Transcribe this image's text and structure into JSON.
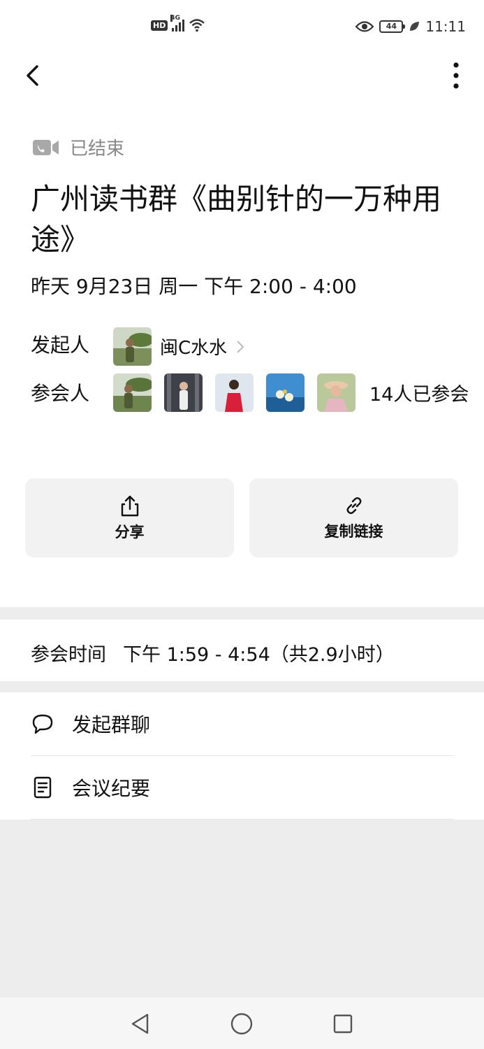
{
  "status_bar": {
    "hd": "HD",
    "network": "4G",
    "battery": "44",
    "time": "11:11",
    "icons": [
      "signal-icon",
      "wifi-icon",
      "eye-icon",
      "battery-icon",
      "leaf-icon"
    ]
  },
  "nav": {
    "back_icon": "chevron-left-icon",
    "more_icon": "more-vertical-icon"
  },
  "meeting": {
    "status": "已结束",
    "title": "广州读书群《曲别针的一万种用途》",
    "datetime": "昨天 9月23日 周一 下午 2:00 - 4:00",
    "organizer_label": "发起人",
    "organizer_name": "闽C水水",
    "participants_label": "参会人",
    "participant_count": "14人已参会"
  },
  "actions": {
    "share": "分享",
    "copy_link": "复制链接"
  },
  "join_time": {
    "label": "参会时间",
    "value": "下午 1:59 - 4:54（共2.9小时）"
  },
  "menu": {
    "group_chat": "发起群聊",
    "minutes": "会议纪要"
  },
  "colors": {
    "accent_gray": "#888888",
    "background": "#ededed",
    "card": "#f2f2f2"
  }
}
